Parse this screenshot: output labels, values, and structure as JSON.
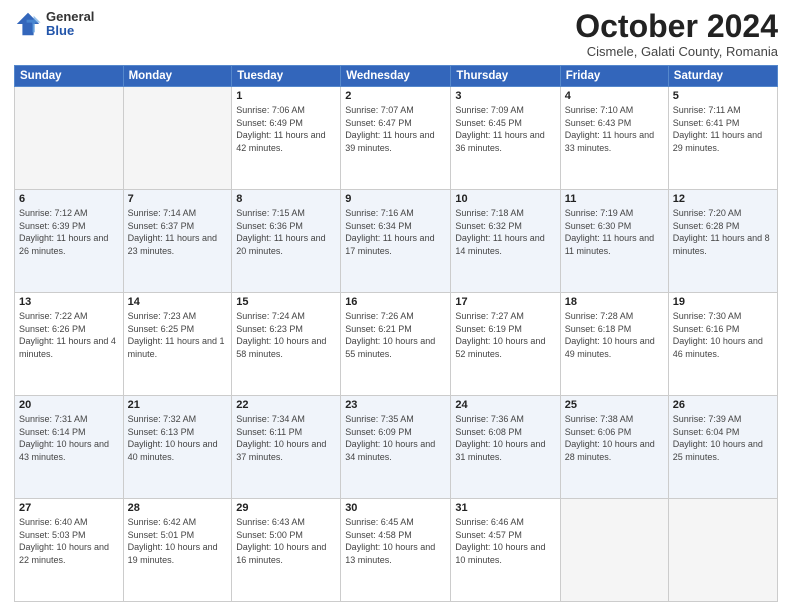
{
  "header": {
    "logo_general": "General",
    "logo_blue": "Blue",
    "month_title": "October 2024",
    "location": "Cismele, Galati County, Romania"
  },
  "weekdays": [
    "Sunday",
    "Monday",
    "Tuesday",
    "Wednesday",
    "Thursday",
    "Friday",
    "Saturday"
  ],
  "weeks": [
    [
      {
        "day": "",
        "sunrise": "",
        "sunset": "",
        "daylight": ""
      },
      {
        "day": "",
        "sunrise": "",
        "sunset": "",
        "daylight": ""
      },
      {
        "day": "1",
        "sunrise": "Sunrise: 7:06 AM",
        "sunset": "Sunset: 6:49 PM",
        "daylight": "Daylight: 11 hours and 42 minutes."
      },
      {
        "day": "2",
        "sunrise": "Sunrise: 7:07 AM",
        "sunset": "Sunset: 6:47 PM",
        "daylight": "Daylight: 11 hours and 39 minutes."
      },
      {
        "day": "3",
        "sunrise": "Sunrise: 7:09 AM",
        "sunset": "Sunset: 6:45 PM",
        "daylight": "Daylight: 11 hours and 36 minutes."
      },
      {
        "day": "4",
        "sunrise": "Sunrise: 7:10 AM",
        "sunset": "Sunset: 6:43 PM",
        "daylight": "Daylight: 11 hours and 33 minutes."
      },
      {
        "day": "5",
        "sunrise": "Sunrise: 7:11 AM",
        "sunset": "Sunset: 6:41 PM",
        "daylight": "Daylight: 11 hours and 29 minutes."
      }
    ],
    [
      {
        "day": "6",
        "sunrise": "Sunrise: 7:12 AM",
        "sunset": "Sunset: 6:39 PM",
        "daylight": "Daylight: 11 hours and 26 minutes."
      },
      {
        "day": "7",
        "sunrise": "Sunrise: 7:14 AM",
        "sunset": "Sunset: 6:37 PM",
        "daylight": "Daylight: 11 hours and 23 minutes."
      },
      {
        "day": "8",
        "sunrise": "Sunrise: 7:15 AM",
        "sunset": "Sunset: 6:36 PM",
        "daylight": "Daylight: 11 hours and 20 minutes."
      },
      {
        "day": "9",
        "sunrise": "Sunrise: 7:16 AM",
        "sunset": "Sunset: 6:34 PM",
        "daylight": "Daylight: 11 hours and 17 minutes."
      },
      {
        "day": "10",
        "sunrise": "Sunrise: 7:18 AM",
        "sunset": "Sunset: 6:32 PM",
        "daylight": "Daylight: 11 hours and 14 minutes."
      },
      {
        "day": "11",
        "sunrise": "Sunrise: 7:19 AM",
        "sunset": "Sunset: 6:30 PM",
        "daylight": "Daylight: 11 hours and 11 minutes."
      },
      {
        "day": "12",
        "sunrise": "Sunrise: 7:20 AM",
        "sunset": "Sunset: 6:28 PM",
        "daylight": "Daylight: 11 hours and 8 minutes."
      }
    ],
    [
      {
        "day": "13",
        "sunrise": "Sunrise: 7:22 AM",
        "sunset": "Sunset: 6:26 PM",
        "daylight": "Daylight: 11 hours and 4 minutes."
      },
      {
        "day": "14",
        "sunrise": "Sunrise: 7:23 AM",
        "sunset": "Sunset: 6:25 PM",
        "daylight": "Daylight: 11 hours and 1 minute."
      },
      {
        "day": "15",
        "sunrise": "Sunrise: 7:24 AM",
        "sunset": "Sunset: 6:23 PM",
        "daylight": "Daylight: 10 hours and 58 minutes."
      },
      {
        "day": "16",
        "sunrise": "Sunrise: 7:26 AM",
        "sunset": "Sunset: 6:21 PM",
        "daylight": "Daylight: 10 hours and 55 minutes."
      },
      {
        "day": "17",
        "sunrise": "Sunrise: 7:27 AM",
        "sunset": "Sunset: 6:19 PM",
        "daylight": "Daylight: 10 hours and 52 minutes."
      },
      {
        "day": "18",
        "sunrise": "Sunrise: 7:28 AM",
        "sunset": "Sunset: 6:18 PM",
        "daylight": "Daylight: 10 hours and 49 minutes."
      },
      {
        "day": "19",
        "sunrise": "Sunrise: 7:30 AM",
        "sunset": "Sunset: 6:16 PM",
        "daylight": "Daylight: 10 hours and 46 minutes."
      }
    ],
    [
      {
        "day": "20",
        "sunrise": "Sunrise: 7:31 AM",
        "sunset": "Sunset: 6:14 PM",
        "daylight": "Daylight: 10 hours and 43 minutes."
      },
      {
        "day": "21",
        "sunrise": "Sunrise: 7:32 AM",
        "sunset": "Sunset: 6:13 PM",
        "daylight": "Daylight: 10 hours and 40 minutes."
      },
      {
        "day": "22",
        "sunrise": "Sunrise: 7:34 AM",
        "sunset": "Sunset: 6:11 PM",
        "daylight": "Daylight: 10 hours and 37 minutes."
      },
      {
        "day": "23",
        "sunrise": "Sunrise: 7:35 AM",
        "sunset": "Sunset: 6:09 PM",
        "daylight": "Daylight: 10 hours and 34 minutes."
      },
      {
        "day": "24",
        "sunrise": "Sunrise: 7:36 AM",
        "sunset": "Sunset: 6:08 PM",
        "daylight": "Daylight: 10 hours and 31 minutes."
      },
      {
        "day": "25",
        "sunrise": "Sunrise: 7:38 AM",
        "sunset": "Sunset: 6:06 PM",
        "daylight": "Daylight: 10 hours and 28 minutes."
      },
      {
        "day": "26",
        "sunrise": "Sunrise: 7:39 AM",
        "sunset": "Sunset: 6:04 PM",
        "daylight": "Daylight: 10 hours and 25 minutes."
      }
    ],
    [
      {
        "day": "27",
        "sunrise": "Sunrise: 6:40 AM",
        "sunset": "Sunset: 5:03 PM",
        "daylight": "Daylight: 10 hours and 22 minutes."
      },
      {
        "day": "28",
        "sunrise": "Sunrise: 6:42 AM",
        "sunset": "Sunset: 5:01 PM",
        "daylight": "Daylight: 10 hours and 19 minutes."
      },
      {
        "day": "29",
        "sunrise": "Sunrise: 6:43 AM",
        "sunset": "Sunset: 5:00 PM",
        "daylight": "Daylight: 10 hours and 16 minutes."
      },
      {
        "day": "30",
        "sunrise": "Sunrise: 6:45 AM",
        "sunset": "Sunset: 4:58 PM",
        "daylight": "Daylight: 10 hours and 13 minutes."
      },
      {
        "day": "31",
        "sunrise": "Sunrise: 6:46 AM",
        "sunset": "Sunset: 4:57 PM",
        "daylight": "Daylight: 10 hours and 10 minutes."
      },
      {
        "day": "",
        "sunrise": "",
        "sunset": "",
        "daylight": ""
      },
      {
        "day": "",
        "sunrise": "",
        "sunset": "",
        "daylight": ""
      }
    ]
  ]
}
